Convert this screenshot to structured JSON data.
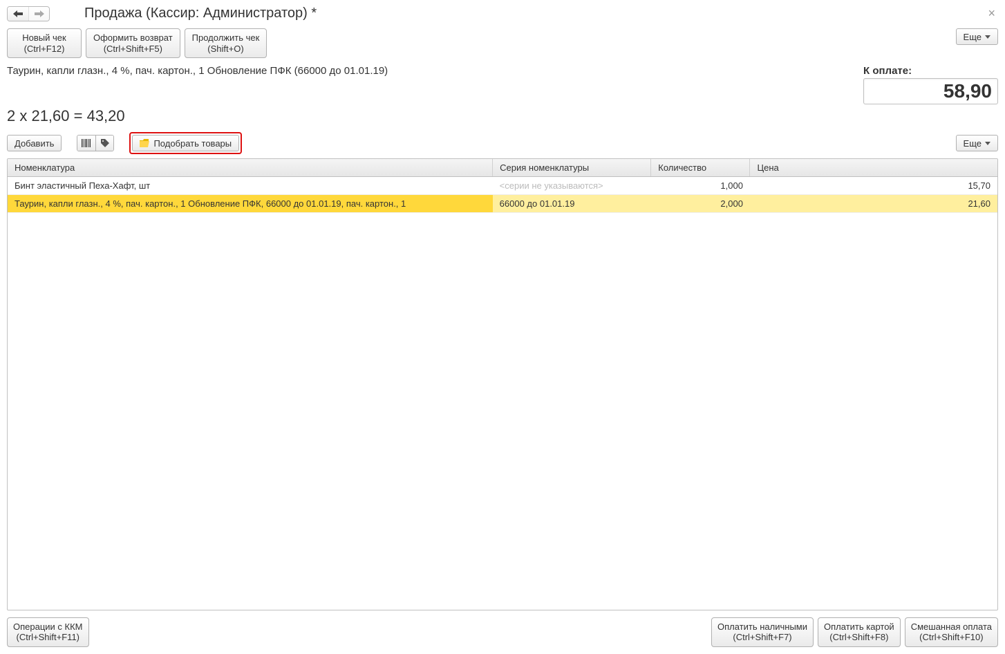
{
  "title": "Продажа (Кассир: Администратор) *",
  "top_buttons": {
    "new_check": {
      "label": "Новый чек",
      "shortcut": "(Ctrl+F12)"
    },
    "return": {
      "label": "Оформить возврат",
      "shortcut": "(Ctrl+Shift+F5)"
    },
    "continue": {
      "label": "Продолжить чек",
      "shortcut": "(Shift+O)"
    }
  },
  "more_label": "Еще",
  "current_item_desc": "Таурин, капли глазн., 4 %, пач. картон., 1  Обновление ПФК (66000 до 01.01.19)",
  "to_pay_label": "К оплате:",
  "to_pay_amount": "58,90",
  "calc_line": "2 x 21,60 = 43,20",
  "toolbar2": {
    "add": "Добавить",
    "select_goods": "Подобрать товары"
  },
  "table": {
    "headers": {
      "name": "Номенклатура",
      "series": "Серия номенклатуры",
      "qty": "Количество",
      "price": "Цена"
    },
    "rows": [
      {
        "name": "Бинт эластичный Пеха-Хафт, шт",
        "series": "<серии не указываются>",
        "series_placeholder": true,
        "qty": "1,000",
        "price": "15,70",
        "selected": false
      },
      {
        "name": "Таурин, капли глазн., 4 %, пач. картон., 1  Обновление ПФК, 66000 до 01.01.19, пач. картон., 1",
        "series": "66000 до 01.01.19",
        "series_placeholder": false,
        "qty": "2,000",
        "price": "21,60",
        "selected": true
      }
    ]
  },
  "footer": {
    "kkm": {
      "label": "Операции с ККМ",
      "shortcut": "(Ctrl+Shift+F11)"
    },
    "cash": {
      "label": "Оплатить наличными",
      "shortcut": "(Ctrl+Shift+F7)"
    },
    "card": {
      "label": "Оплатить картой",
      "shortcut": "(Ctrl+Shift+F8)"
    },
    "mixed": {
      "label": "Смешанная оплата",
      "shortcut": "(Ctrl+Shift+F10)"
    }
  }
}
